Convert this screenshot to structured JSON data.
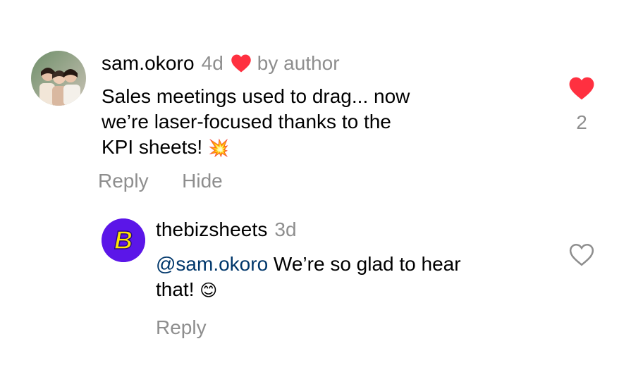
{
  "comments": [
    {
      "username": "sam.okoro",
      "time": "4d",
      "author_like_label": "by author",
      "text_lines": [
        "Sales meetings used to drag... now",
        "we’re laser-focused thanks to the",
        "KPI sheets!"
      ],
      "emoji": "💥",
      "actions": {
        "reply": "Reply",
        "hide": "Hide"
      },
      "like_count": "2",
      "liked": true,
      "avatar": "group-photo-avatar"
    }
  ],
  "replies": [
    {
      "username": "thebizsheets",
      "time": "3d",
      "mention": "@sam.okoro",
      "text_line1": "We’re so glad to hear",
      "text_line2": "that!",
      "emoji": "😊",
      "actions": {
        "reply": "Reply"
      },
      "liked": false,
      "avatar_letter": "B"
    }
  ],
  "colors": {
    "heart_red": "#ff3040",
    "meta_gray": "#8e8e8e",
    "mention_blue": "#00376b",
    "brand_purple": "#5b16e8",
    "brand_yellow": "#ffe600"
  }
}
